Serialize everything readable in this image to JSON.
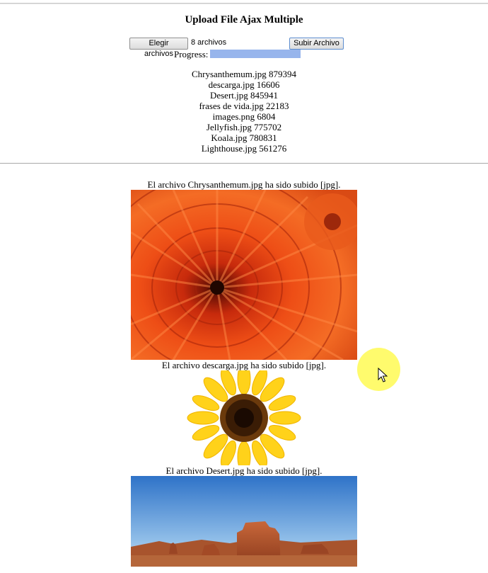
{
  "page": {
    "title": "Upload File Ajax Multiple"
  },
  "form": {
    "choose_button": "Elegir archivos",
    "file_count": "8 archivos",
    "upload_button": "Subir Archivo",
    "progress_label": "Progress:",
    "progress_fraction": 1.0
  },
  "files": [
    {
      "text": "Chrysanthemum.jpg 879394"
    },
    {
      "text": "descarga.jpg 16606"
    },
    {
      "text": "Desert.jpg 845941"
    },
    {
      "text": "frases de vida.jpg 22183"
    },
    {
      "text": "images.png 6804"
    },
    {
      "text": "Jellyfish.jpg 775702"
    },
    {
      "text": "Koala.jpg 780831"
    },
    {
      "text": "Lighthouse.jpg 561276"
    }
  ],
  "results": [
    {
      "message": "El archivo Chrysanthemum.jpg ha sido subido [jpg].",
      "image": "chrysanthemum-photo"
    },
    {
      "message": "El archivo descarga.jpg ha sido subido [jpg].",
      "image": "sunflower-photo"
    },
    {
      "message": "El archivo Desert.jpg ha sido subido [jpg].",
      "image": "desert-photo"
    }
  ],
  "colors": {
    "progress_fill": "#97b5ec",
    "cursor_highlight": "#fffa3c"
  }
}
